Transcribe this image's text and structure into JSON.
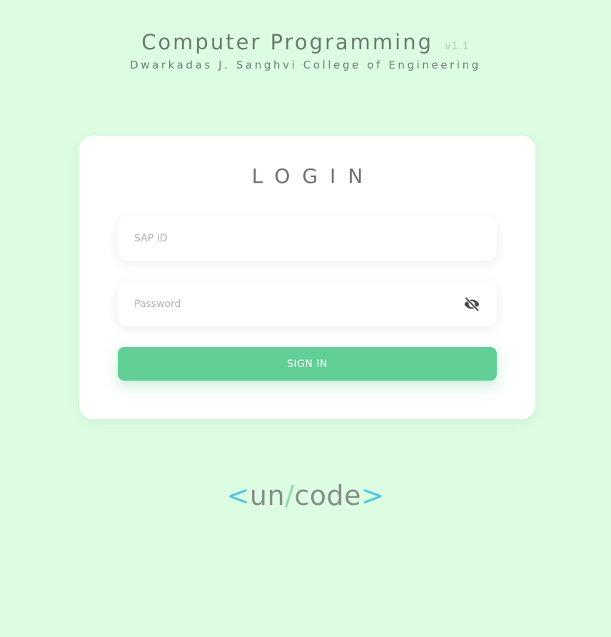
{
  "header": {
    "title": "Computer Programming",
    "version": "v1.1",
    "subtitle": "Dwarkadas J. Sanghvi College of Engineering"
  },
  "login": {
    "heading": "LOGIN",
    "sap_id_placeholder": "SAP ID",
    "sap_id_value": "",
    "password_placeholder": "Password",
    "password_value": "",
    "password_toggle_icon": "eye-off-icon",
    "signin_label": "SIGN IN"
  },
  "logo": {
    "open_bracket": "<",
    "part1": "un",
    "slash": "/",
    "part2": "code",
    "close_bracket": ">"
  },
  "colors": {
    "background": "#ddfde2",
    "accent": "#62cf96",
    "logo_bracket": "#4fc8dc",
    "logo_slash": "#8fd9a8"
  }
}
